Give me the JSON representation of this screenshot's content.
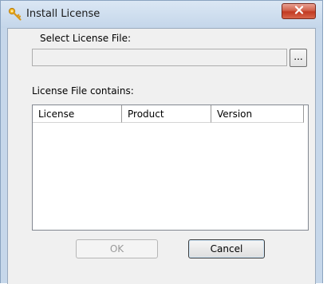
{
  "window": {
    "title": "Install License",
    "close_symbol": "x"
  },
  "form": {
    "select_label": "Select License File:",
    "file_value": "",
    "browse_label": "...",
    "contains_label": "License File contains:"
  },
  "table": {
    "columns": [
      "License",
      "Product",
      "Version"
    ],
    "rows": []
  },
  "buttons": {
    "ok_label": "OK",
    "cancel_label": "Cancel"
  },
  "colors": {
    "frame": "#c6d7ea",
    "client": "#f0f0f0",
    "close_red": "#c23a22",
    "icon_gold": "#e8a31b"
  }
}
